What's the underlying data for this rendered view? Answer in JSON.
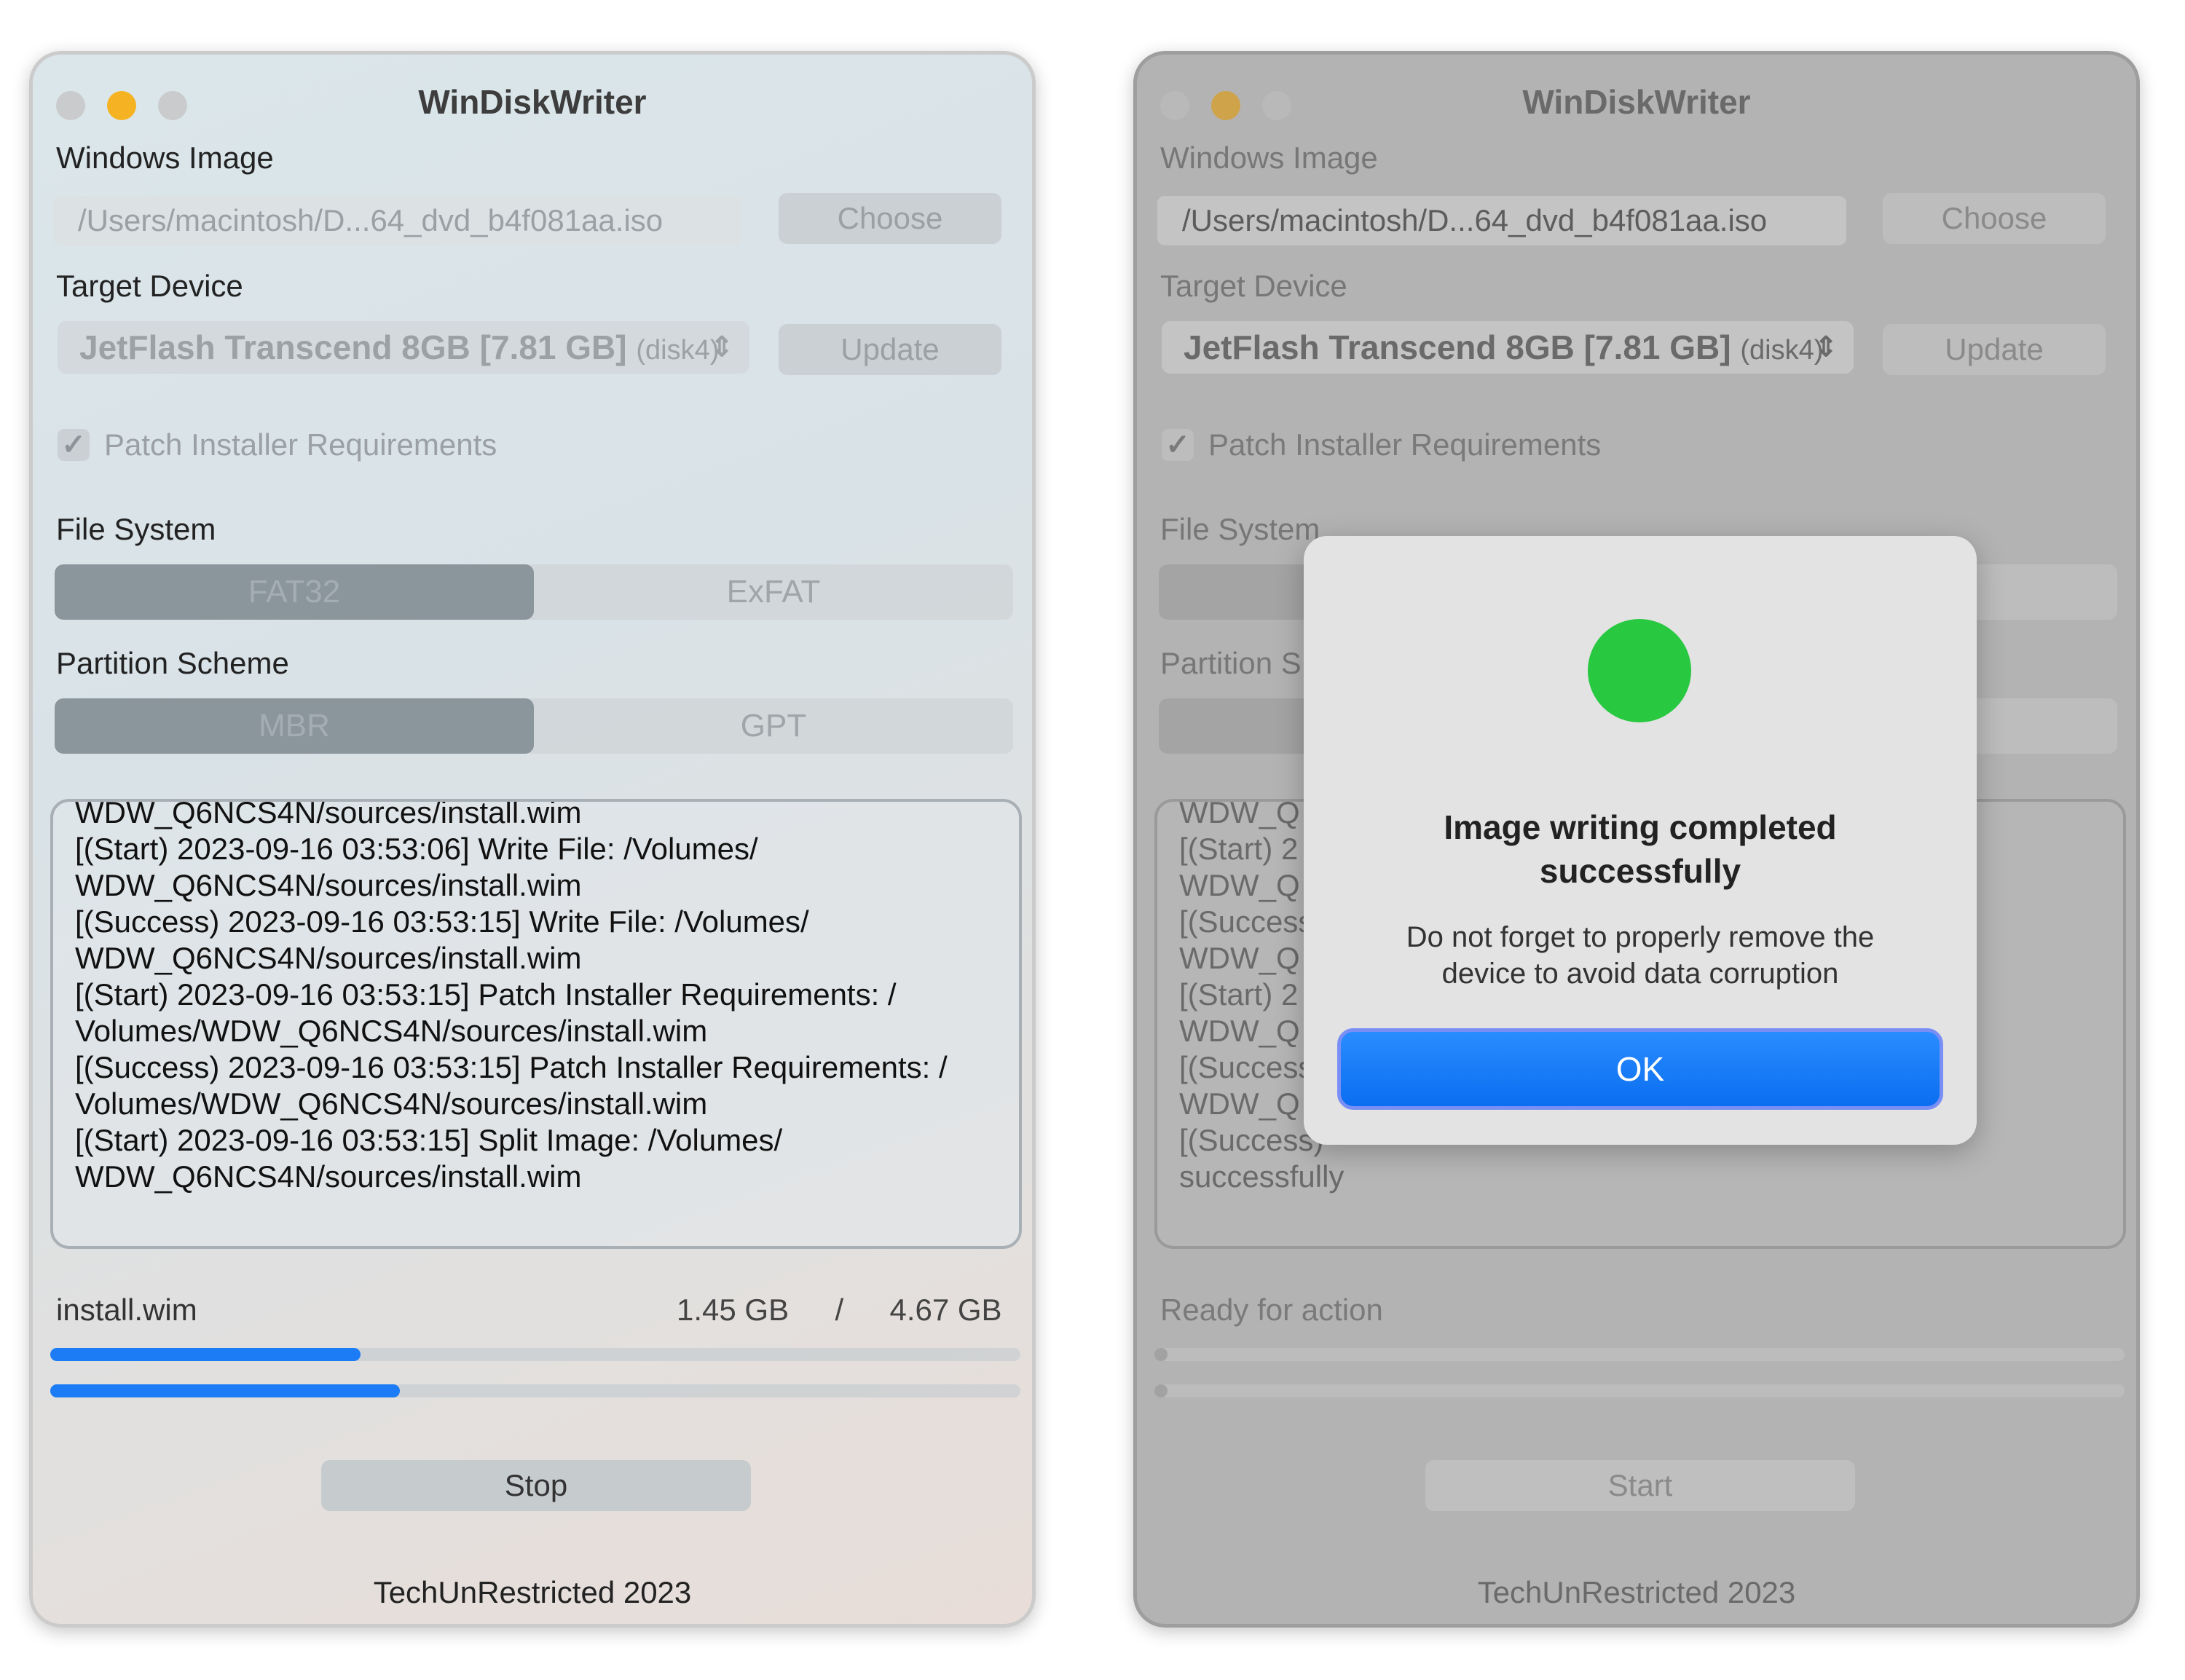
{
  "left_window": {
    "title": "WinDiskWriter",
    "windows_image": {
      "label": "Windows Image",
      "path": "/Users/macintosh/D...64_dvd_b4f081aa.iso",
      "choose_label": "Choose"
    },
    "target_device": {
      "label": "Target Device",
      "device_name": "JetFlash Transcend 8GB [7.81 GB]",
      "device_id": "(disk4)",
      "update_label": "Update"
    },
    "patch_checkbox": {
      "label": "Patch Installer Requirements",
      "checked": true
    },
    "file_system": {
      "label": "File System",
      "options": [
        "FAT32",
        "ExFAT"
      ],
      "selected": "FAT32"
    },
    "partition_scheme": {
      "label": "Partition Scheme",
      "options": [
        "MBR",
        "GPT"
      ],
      "selected": "MBR"
    },
    "log": [
      "WDW_Q6NCS4N/sources/install.wim",
      "[(Start) 2023-09-16 03:53:06] Write File: /Volumes/",
      "WDW_Q6NCS4N/sources/install.wim",
      "[(Success) 2023-09-16 03:53:15] Write File: /Volumes/",
      "WDW_Q6NCS4N/sources/install.wim",
      "[(Start) 2023-09-16 03:53:15] Patch Installer Requirements: /",
      "Volumes/WDW_Q6NCS4N/sources/install.wim",
      "[(Success) 2023-09-16 03:53:15] Patch Installer Requirements: /",
      "Volumes/WDW_Q6NCS4N/sources/install.wim",
      "[(Start) 2023-09-16 03:53:15] Split Image: /Volumes/",
      "WDW_Q6NCS4N/sources/install.wim"
    ],
    "progress": {
      "file_name": "install.wim",
      "current_size": "1.45 GB",
      "separator": "/",
      "total_size": "4.67 GB",
      "file_fraction": 0.32,
      "overall_fraction": 0.36
    },
    "action_button": "Stop",
    "footer": "TechUnRestricted 2023"
  },
  "right_window": {
    "title": "WinDiskWriter",
    "windows_image": {
      "label": "Windows Image",
      "path": "/Users/macintosh/D...64_dvd_b4f081aa.iso",
      "choose_label": "Choose"
    },
    "target_device": {
      "label": "Target Device",
      "device_name": "JetFlash Transcend 8GB [7.81 GB]",
      "device_id": "(disk4)",
      "update_label": "Update"
    },
    "patch_checkbox": {
      "label": "Patch Installer Requirements",
      "checked": true
    },
    "file_system": {
      "label": "File System"
    },
    "partition_scheme": {
      "label": "Partition S"
    },
    "log": [
      "WDW_Q",
      "[(Start) 2",
      "WDW_Q",
      "[(Success",
      "WDW_Q",
      "[(Start) 2",
      "WDW_Q",
      "[(Success",
      "WDW_Q",
      "[(Success)",
      "successfully"
    ],
    "status": "Ready for action",
    "progress": {
      "file_fraction": 0.0,
      "overall_fraction": 0.0
    },
    "action_button": "Start",
    "footer": "TechUnRestricted 2023"
  },
  "alert": {
    "title_line1": "Image writing completed",
    "title_line2": "successfully",
    "message_line1": "Do not forget to properly remove the",
    "message_line2": "device to avoid data corruption",
    "ok_label": "OK",
    "status_color": "#28c840"
  },
  "colors": {
    "accent": "#1c7cf5",
    "traffic_close": "#c9cbcc",
    "traffic_minimize": "#f5b323",
    "traffic_zoom": "#c9cbcc"
  }
}
